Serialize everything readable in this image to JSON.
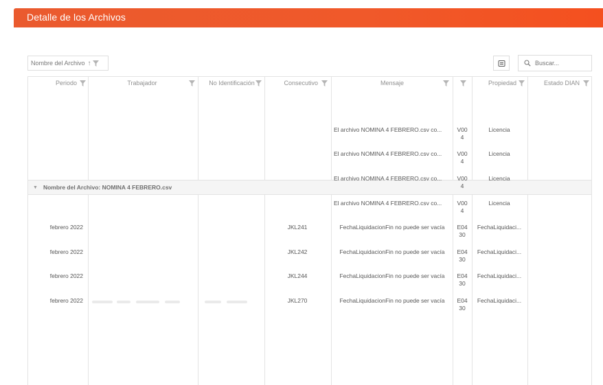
{
  "header": {
    "title": "Detalle de los Archivos"
  },
  "toolbar": {
    "group_chip_label": "Nombre del Archivo",
    "search_placeholder": "Buscar..."
  },
  "columns": [
    {
      "label": "Periodo"
    },
    {
      "label": "Trabajador"
    },
    {
      "label": "No Identificación"
    },
    {
      "label": "Consecutivo"
    },
    {
      "label": "Mensaje"
    },
    {
      "label": ""
    },
    {
      "label": "Propiedad"
    },
    {
      "label": "Estado DIAN"
    }
  ],
  "group": {
    "label": "Nombre del Archivo: NOMINA 4 FEBRERO.csv"
  },
  "rows": [
    {
      "periodo": "",
      "consecutivo": "",
      "mensaje": "El archivo NOMINA 4 FEBRERO.csv co...",
      "codigo": "V004",
      "propiedad": "Licencia"
    },
    {
      "periodo": "",
      "consecutivo": "",
      "mensaje": "El archivo NOMINA 4 FEBRERO.csv co...",
      "codigo": "V004",
      "propiedad": "Licencia"
    },
    {
      "periodo": "",
      "consecutivo": "",
      "mensaje": "El archivo NOMINA 4 FEBRERO.csv co...",
      "codigo": "V004",
      "propiedad": "Licencia"
    },
    {
      "periodo": "",
      "consecutivo": "",
      "mensaje": "El archivo NOMINA 4 FEBRERO.csv co...",
      "codigo": "V004",
      "propiedad": "Licencia"
    },
    {
      "periodo": "febrero 2022",
      "consecutivo": "JKL241",
      "mensaje": "FechaLiquidacionFin no puede ser vacía",
      "codigo": "E0430",
      "propiedad": "FechaLiquidaci..."
    },
    {
      "periodo": "febrero 2022",
      "consecutivo": "JKL242",
      "mensaje": "FechaLiquidacionFin no puede ser vacía",
      "codigo": "E0430",
      "propiedad": "FechaLiquidaci..."
    },
    {
      "periodo": "febrero 2022",
      "consecutivo": "JKL244",
      "mensaje": "FechaLiquidacionFin no puede ser vacía",
      "codigo": "E0430",
      "propiedad": "FechaLiquidaci..."
    },
    {
      "periodo": "febrero 2022",
      "consecutivo": "JKL270",
      "mensaje": "FechaLiquidacionFin no puede ser vacía",
      "codigo": "E0430",
      "propiedad": "FechaLiquidaci..."
    }
  ],
  "colors": {
    "accent": "#f0592a",
    "grid_line": "#e3e3e3",
    "group_row_bg": "#f5f5f5"
  },
  "icons": {
    "filter": "funnel-icon",
    "sort": "sort-up-icon",
    "export": "export-icon",
    "search": "search-icon",
    "collapse": "caret-down-icon"
  }
}
